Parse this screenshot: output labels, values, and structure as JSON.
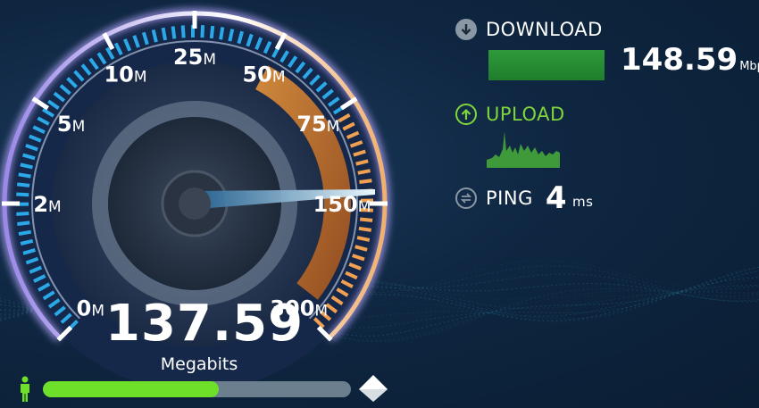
{
  "gauge": {
    "ticks": [
      {
        "num": "0",
        "unit": "M"
      },
      {
        "num": "2",
        "unit": "M"
      },
      {
        "num": "5",
        "unit": "M"
      },
      {
        "num": "10",
        "unit": "M"
      },
      {
        "num": "25",
        "unit": "M"
      },
      {
        "num": "50",
        "unit": "M"
      },
      {
        "num": "75",
        "unit": "M"
      },
      {
        "num": "150",
        "unit": "M"
      },
      {
        "num": "300",
        "unit": "M"
      }
    ],
    "current_speed": "137.59",
    "current_unit": "Megabits",
    "progress_fraction": 0.57
  },
  "download": {
    "label": "DOWNLOAD",
    "value": "148.59",
    "unit": "Mbps"
  },
  "upload": {
    "label": "UPLOAD"
  },
  "ping": {
    "label": "PING",
    "value": "4",
    "unit": "ms"
  },
  "colors": {
    "accent_green": "#6ee02a",
    "download_bar": "#2f9a3a",
    "upload_green": "#7fd63a",
    "gauge_blue": "#2aa8e8",
    "gauge_orange": "#e07a2a",
    "text_white": "#ffffff"
  }
}
